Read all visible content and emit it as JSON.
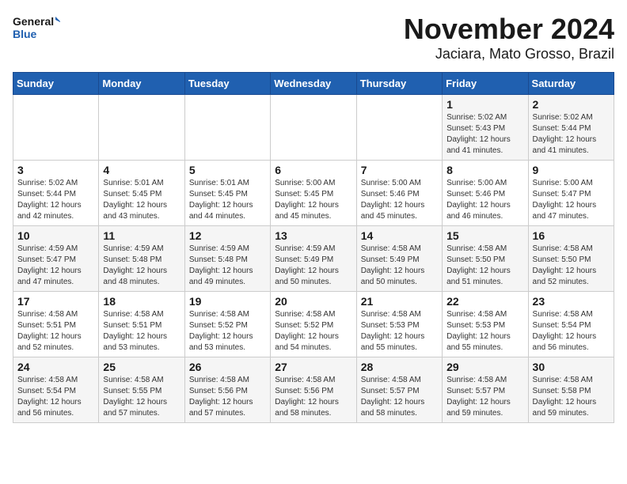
{
  "logo": {
    "line1": "General",
    "line2": "Blue"
  },
  "title": "November 2024",
  "location": "Jaciara, Mato Grosso, Brazil",
  "days_of_week": [
    "Sunday",
    "Monday",
    "Tuesday",
    "Wednesday",
    "Thursday",
    "Friday",
    "Saturday"
  ],
  "weeks": [
    [
      {
        "day": "",
        "info": ""
      },
      {
        "day": "",
        "info": ""
      },
      {
        "day": "",
        "info": ""
      },
      {
        "day": "",
        "info": ""
      },
      {
        "day": "",
        "info": ""
      },
      {
        "day": "1",
        "info": "Sunrise: 5:02 AM\nSunset: 5:43 PM\nDaylight: 12 hours\nand 41 minutes."
      },
      {
        "day": "2",
        "info": "Sunrise: 5:02 AM\nSunset: 5:44 PM\nDaylight: 12 hours\nand 41 minutes."
      }
    ],
    [
      {
        "day": "3",
        "info": "Sunrise: 5:02 AM\nSunset: 5:44 PM\nDaylight: 12 hours\nand 42 minutes."
      },
      {
        "day": "4",
        "info": "Sunrise: 5:01 AM\nSunset: 5:45 PM\nDaylight: 12 hours\nand 43 minutes."
      },
      {
        "day": "5",
        "info": "Sunrise: 5:01 AM\nSunset: 5:45 PM\nDaylight: 12 hours\nand 44 minutes."
      },
      {
        "day": "6",
        "info": "Sunrise: 5:00 AM\nSunset: 5:45 PM\nDaylight: 12 hours\nand 45 minutes."
      },
      {
        "day": "7",
        "info": "Sunrise: 5:00 AM\nSunset: 5:46 PM\nDaylight: 12 hours\nand 45 minutes."
      },
      {
        "day": "8",
        "info": "Sunrise: 5:00 AM\nSunset: 5:46 PM\nDaylight: 12 hours\nand 46 minutes."
      },
      {
        "day": "9",
        "info": "Sunrise: 5:00 AM\nSunset: 5:47 PM\nDaylight: 12 hours\nand 47 minutes."
      }
    ],
    [
      {
        "day": "10",
        "info": "Sunrise: 4:59 AM\nSunset: 5:47 PM\nDaylight: 12 hours\nand 47 minutes."
      },
      {
        "day": "11",
        "info": "Sunrise: 4:59 AM\nSunset: 5:48 PM\nDaylight: 12 hours\nand 48 minutes."
      },
      {
        "day": "12",
        "info": "Sunrise: 4:59 AM\nSunset: 5:48 PM\nDaylight: 12 hours\nand 49 minutes."
      },
      {
        "day": "13",
        "info": "Sunrise: 4:59 AM\nSunset: 5:49 PM\nDaylight: 12 hours\nand 50 minutes."
      },
      {
        "day": "14",
        "info": "Sunrise: 4:58 AM\nSunset: 5:49 PM\nDaylight: 12 hours\nand 50 minutes."
      },
      {
        "day": "15",
        "info": "Sunrise: 4:58 AM\nSunset: 5:50 PM\nDaylight: 12 hours\nand 51 minutes."
      },
      {
        "day": "16",
        "info": "Sunrise: 4:58 AM\nSunset: 5:50 PM\nDaylight: 12 hours\nand 52 minutes."
      }
    ],
    [
      {
        "day": "17",
        "info": "Sunrise: 4:58 AM\nSunset: 5:51 PM\nDaylight: 12 hours\nand 52 minutes."
      },
      {
        "day": "18",
        "info": "Sunrise: 4:58 AM\nSunset: 5:51 PM\nDaylight: 12 hours\nand 53 minutes."
      },
      {
        "day": "19",
        "info": "Sunrise: 4:58 AM\nSunset: 5:52 PM\nDaylight: 12 hours\nand 53 minutes."
      },
      {
        "day": "20",
        "info": "Sunrise: 4:58 AM\nSunset: 5:52 PM\nDaylight: 12 hours\nand 54 minutes."
      },
      {
        "day": "21",
        "info": "Sunrise: 4:58 AM\nSunset: 5:53 PM\nDaylight: 12 hours\nand 55 minutes."
      },
      {
        "day": "22",
        "info": "Sunrise: 4:58 AM\nSunset: 5:53 PM\nDaylight: 12 hours\nand 55 minutes."
      },
      {
        "day": "23",
        "info": "Sunrise: 4:58 AM\nSunset: 5:54 PM\nDaylight: 12 hours\nand 56 minutes."
      }
    ],
    [
      {
        "day": "24",
        "info": "Sunrise: 4:58 AM\nSunset: 5:54 PM\nDaylight: 12 hours\nand 56 minutes."
      },
      {
        "day": "25",
        "info": "Sunrise: 4:58 AM\nSunset: 5:55 PM\nDaylight: 12 hours\nand 57 minutes."
      },
      {
        "day": "26",
        "info": "Sunrise: 4:58 AM\nSunset: 5:56 PM\nDaylight: 12 hours\nand 57 minutes."
      },
      {
        "day": "27",
        "info": "Sunrise: 4:58 AM\nSunset: 5:56 PM\nDaylight: 12 hours\nand 58 minutes."
      },
      {
        "day": "28",
        "info": "Sunrise: 4:58 AM\nSunset: 5:57 PM\nDaylight: 12 hours\nand 58 minutes."
      },
      {
        "day": "29",
        "info": "Sunrise: 4:58 AM\nSunset: 5:57 PM\nDaylight: 12 hours\nand 59 minutes."
      },
      {
        "day": "30",
        "info": "Sunrise: 4:58 AM\nSunset: 5:58 PM\nDaylight: 12 hours\nand 59 minutes."
      }
    ]
  ]
}
